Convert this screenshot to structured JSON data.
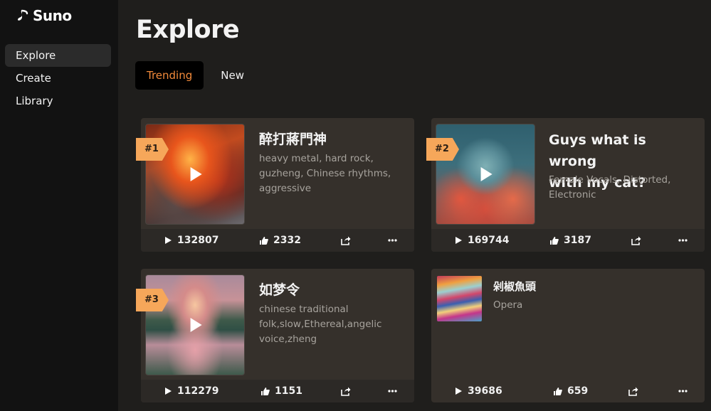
{
  "app": {
    "name": "Suno"
  },
  "sidebar": {
    "items": [
      {
        "label": "Explore",
        "active": true
      },
      {
        "label": "Create",
        "active": false
      },
      {
        "label": "Library",
        "active": false
      }
    ]
  },
  "page": {
    "title": "Explore"
  },
  "tabs": [
    {
      "label": "Trending",
      "active": true
    },
    {
      "label": "New",
      "active": false
    }
  ],
  "colors": {
    "accent": "#f28a3a",
    "badge": "#f6a75a",
    "card": "#35302b",
    "sidebar": "#121212"
  },
  "songs": [
    {
      "rank": "#1",
      "title": "醉打蔣門神",
      "tags": [
        "heavy metal, hard rock,",
        "guzheng, Chinese rhythms,",
        "aggressive"
      ],
      "plays": "132807",
      "likes": "2332",
      "art": "dragon"
    },
    {
      "rank": "#2",
      "title_lines": [
        "Guys what is wrong",
        "with my cat?"
      ],
      "tags": [
        "Female Vocals, Distorted,",
        "Electronic"
      ],
      "plays": "169744",
      "likes": "3187",
      "art": "cat"
    },
    {
      "rank": "#3",
      "title": "如梦令",
      "tags": [
        "chinese traditional",
        "folk,slow,Ethereal,angelic",
        "voice,zheng"
      ],
      "plays": "112279",
      "likes": "1151",
      "art": "lotus-pond"
    },
    {
      "title": "剁椒魚頭",
      "tags": [
        "Opera"
      ],
      "plays": "39686",
      "likes": "659",
      "art": "colorful-waves"
    }
  ]
}
